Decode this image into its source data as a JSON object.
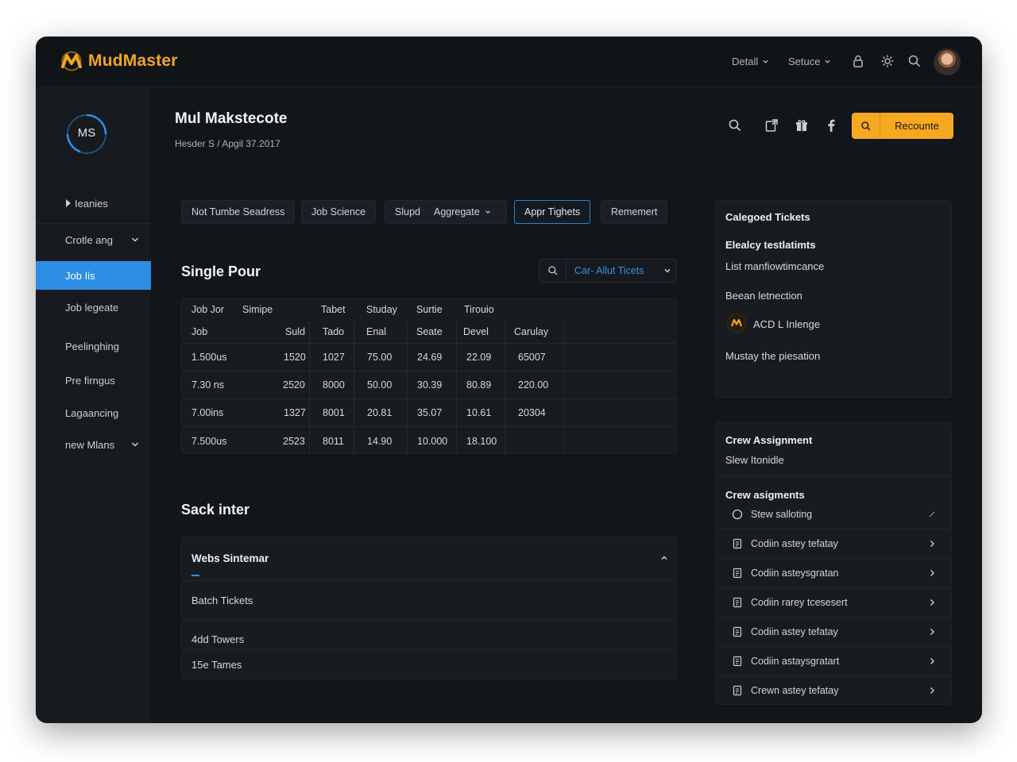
{
  "brand": {
    "name": "MudMaster"
  },
  "topbar": {
    "menus": [
      "Detall",
      "Setuce"
    ],
    "icons": [
      "lock-icon",
      "settings-icon",
      "search-icon"
    ]
  },
  "sidebar": {
    "logo_text": "MS",
    "items": [
      {
        "label": "Ieanies"
      },
      {
        "label": "Crotle ang"
      },
      {
        "label": "Job Iis"
      },
      {
        "label": "Job legeate"
      },
      {
        "label": "Peelinghing"
      },
      {
        "label": "Pre firngus"
      },
      {
        "label": "Lagaancing"
      },
      {
        "label": "new Mlans"
      }
    ]
  },
  "header": {
    "title": "Mul Makstecote",
    "subtitle": "Hesder S / Apgil 37.2017",
    "primary_button": "Recounte"
  },
  "tabs": [
    "Not Tumbe Seadress",
    "Job Science",
    "Slupd",
    "Aggregate",
    "Appr Tighets",
    "Rememert"
  ],
  "single_pour": {
    "title": "Single Pour",
    "filter_label": "Car- Allut Ticets",
    "header_row1": [
      "Job Jor",
      "Simipe",
      "Tabet",
      "Studay",
      "Surtie",
      "Tirouio"
    ],
    "header_row2": [
      "Job",
      "Suld",
      "Tado",
      "Enal",
      "Seate",
      "Devel",
      "Carulay"
    ],
    "rows": [
      [
        "1.500us",
        "1520",
        "1027",
        "75.00",
        "24.69",
        "22.09",
        "65007"
      ],
      [
        "7.30 ns",
        "2520",
        "8000",
        "50.00",
        "30.39",
        "80.89",
        "220.00"
      ],
      [
        "7.00ins",
        "1327",
        "8001",
        "20.81",
        "35.07",
        "10.61",
        "20304"
      ],
      [
        "7.500us",
        "2523",
        "8011",
        "14.90",
        "10.000",
        "18.100",
        ""
      ]
    ]
  },
  "sack_inter": {
    "title": "Sack inter",
    "header": "Webs Sintemar",
    "rows": [
      "Batch Tickets",
      "4dd Towers",
      "15e Tames"
    ]
  },
  "categorized": {
    "title": "Calegoed Tickets",
    "subtitle": "Elealcy testlatimts",
    "line1": "List manfiowtimcance",
    "line2": "Beean letnection",
    "item": "ACD L Inlenge",
    "line3": "Mustay the piesation"
  },
  "crew": {
    "title": "Crew Assignment",
    "subtitle": "Slew Itonidle",
    "list_title": "Crew asigments",
    "first_item": "Stew salloting",
    "items": [
      "Codiin astey tefatay",
      "Codiin asteysgratan",
      "Codiin rarey tcesesert",
      "Codiin astey tefatay",
      "Codiin astaysgratart",
      "Crewn astey tefatay"
    ]
  },
  "colors": {
    "accent": "#f6a821",
    "active": "#2d8ee6",
    "link": "#3d8fe0",
    "bg": "#121519"
  }
}
